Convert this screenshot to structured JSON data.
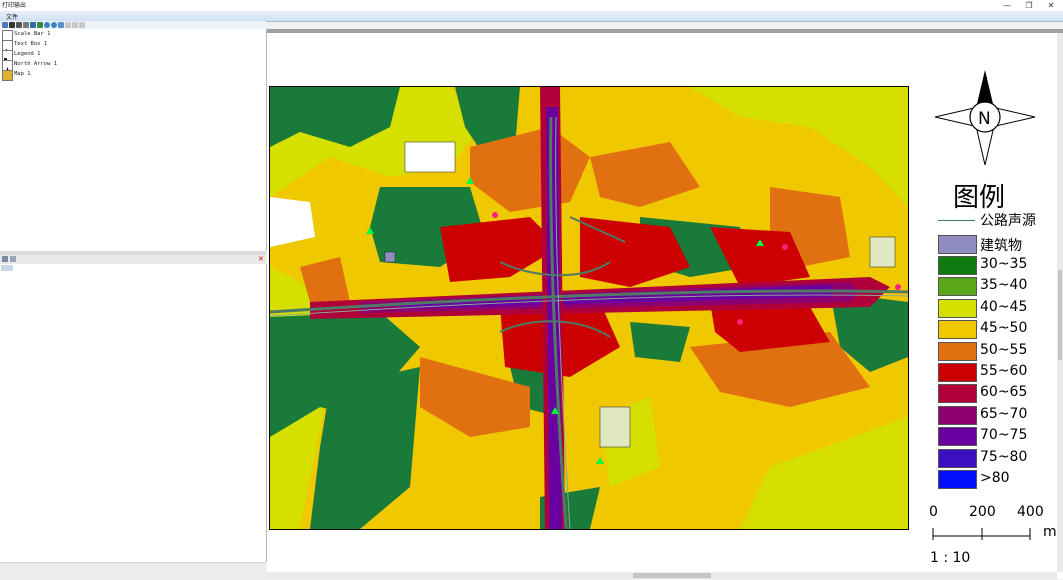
{
  "window": {
    "title": "打印输出",
    "controls": [
      "—",
      "❐",
      "✕"
    ]
  },
  "menu": {
    "file_label": "文件"
  },
  "layout_tree": {
    "items": [
      {
        "label": "Scale Bar 1",
        "icon": "scale-bar-icon"
      },
      {
        "label": "Text Box 1",
        "icon": "text-box-icon"
      },
      {
        "label": "Legend 1",
        "icon": "legend-icon"
      },
      {
        "label": "North Arrow 1",
        "icon": "north-arrow-icon"
      },
      {
        "label": "Map 1",
        "icon": "map-icon"
      }
    ]
  },
  "properties": {
    "close_label": "✕"
  },
  "legend": {
    "title": "图例",
    "road_label": "公路声源",
    "building_label": "建筑物",
    "building_color": "#8e8cc0",
    "road_color": "#3d7a55",
    "classes": [
      {
        "label": "30~35",
        "color": "#0f7a0f"
      },
      {
        "label": "35~40",
        "color": "#5aa61a"
      },
      {
        "label": "40~45",
        "color": "#d5e000"
      },
      {
        "label": "45~50",
        "color": "#f0c800"
      },
      {
        "label": "50~55",
        "color": "#e07010"
      },
      {
        "label": "55~60",
        "color": "#cc0000"
      },
      {
        "label": "60~65",
        "color": "#b0003a"
      },
      {
        "label": "65~70",
        "color": "#8e0070"
      },
      {
        "label": "70~75",
        "color": "#6a00a0"
      },
      {
        "label": "75~80",
        "color": "#3a10c0"
      },
      {
        "label": ">80",
        "color": "#0010ff"
      }
    ]
  },
  "north_arrow": {
    "letter": "N"
  },
  "scale_bar": {
    "ticks": [
      "0",
      "200",
      "400"
    ],
    "unit": "m",
    "ratio": "1 : 10"
  }
}
